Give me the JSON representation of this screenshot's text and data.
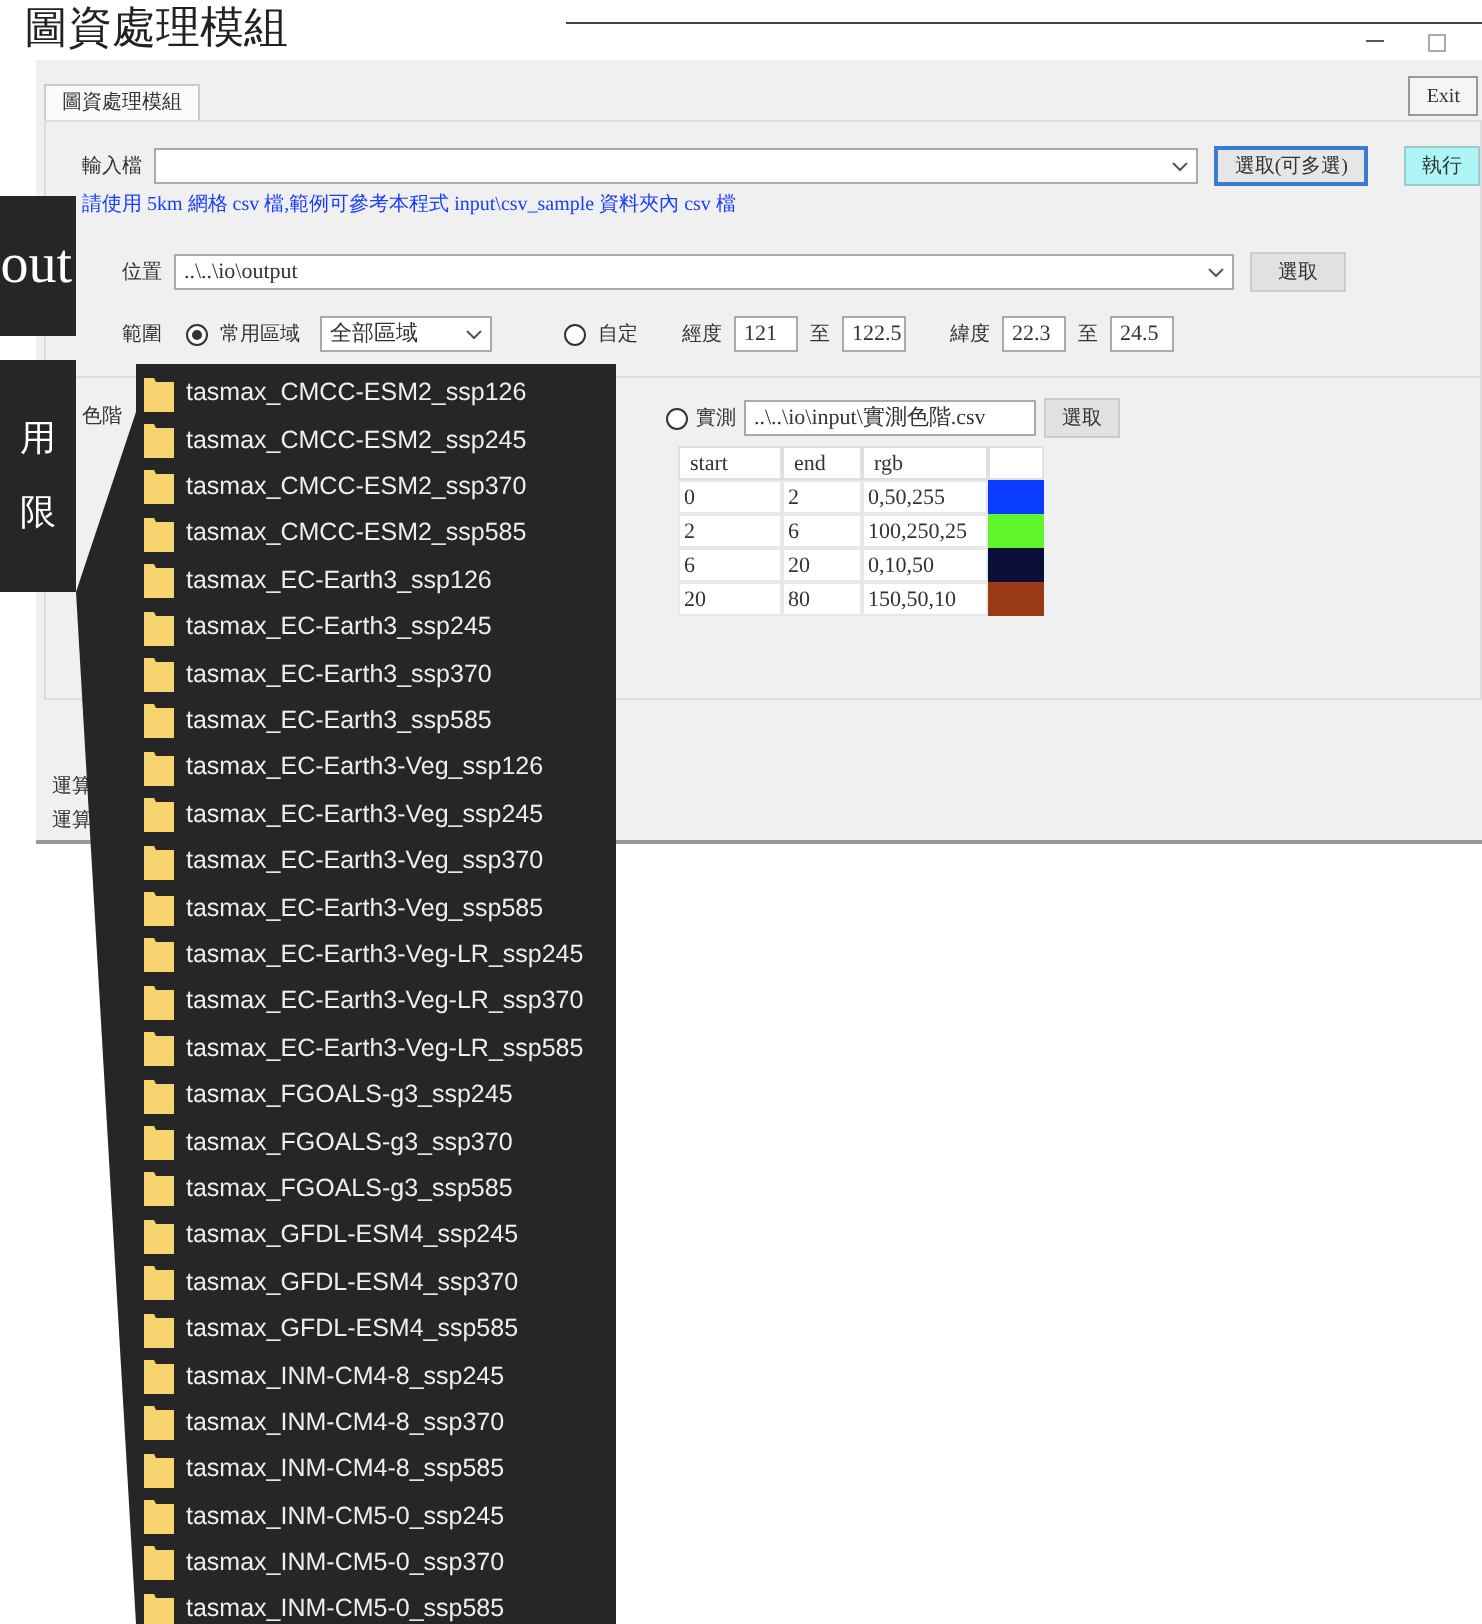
{
  "slide_title": "圖資處理模組",
  "window": {
    "tabs": [
      {
        "label": "圖資處理模組",
        "selected": true
      }
    ],
    "exit_button": "Exit",
    "input": {
      "label": "輸入檔",
      "button": "選取(可多選)",
      "run_button": "執行",
      "hint": "請使用 5km 網格 csv 檔,範例可參考本程式 input\\csv_sample 資料夾內 csv 檔"
    },
    "output": {
      "label": "位置",
      "value": "..\\..\\io\\output",
      "button": "選取"
    },
    "range": {
      "label": "範圍",
      "options": [
        {
          "kind": "preset",
          "label": "常用區域",
          "selected": true,
          "value": "全部區域"
        },
        {
          "kind": "custom",
          "label": "自定",
          "selected": false
        }
      ],
      "lon_label": "經度",
      "lon_from": "121",
      "lon_sep": "至",
      "lon_to": "122.5",
      "lat_label": "緯度",
      "lat_from": "22.3",
      "lat_sep": "至",
      "lat_to": "24.5"
    },
    "color_scale": {
      "label": "色階",
      "option": {
        "label": "實測",
        "selected": false
      },
      "file": "..\\..\\io\\input\\實測色階.csv",
      "button": "選取",
      "columns": [
        "start",
        "end",
        "rgb"
      ],
      "rows": [
        {
          "start": "0",
          "end": "2",
          "rgb": "0,50,255",
          "color": "#0a3cff"
        },
        {
          "start": "2",
          "end": "6",
          "rgb": "100,250,25",
          "color": "#5ef52a"
        },
        {
          "start": "6",
          "end": "20",
          "rgb": "0,10,50",
          "color": "#0a0f38"
        },
        {
          "start": "20",
          "end": "80",
          "rgb": "150,50,10",
          "color": "#9a3a14"
        }
      ]
    },
    "status_lines": [
      "運算",
      "運算"
    ]
  },
  "callouts": [
    "out",
    "用",
    "限"
  ],
  "file_list": [
    "tasmax_CMCC-ESM2_ssp126",
    "tasmax_CMCC-ESM2_ssp245",
    "tasmax_CMCC-ESM2_ssp370",
    "tasmax_CMCC-ESM2_ssp585",
    "tasmax_EC-Earth3_ssp126",
    "tasmax_EC-Earth3_ssp245",
    "tasmax_EC-Earth3_ssp370",
    "tasmax_EC-Earth3_ssp585",
    "tasmax_EC-Earth3-Veg_ssp126",
    "tasmax_EC-Earth3-Veg_ssp245",
    "tasmax_EC-Earth3-Veg_ssp370",
    "tasmax_EC-Earth3-Veg_ssp585",
    "tasmax_EC-Earth3-Veg-LR_ssp245",
    "tasmax_EC-Earth3-Veg-LR_ssp370",
    "tasmax_EC-Earth3-Veg-LR_ssp585",
    "tasmax_FGOALS-g3_ssp245",
    "tasmax_FGOALS-g3_ssp370",
    "tasmax_FGOALS-g3_ssp585",
    "tasmax_GFDL-ESM4_ssp245",
    "tasmax_GFDL-ESM4_ssp370",
    "tasmax_GFDL-ESM4_ssp585",
    "tasmax_INM-CM4-8_ssp245",
    "tasmax_INM-CM4-8_ssp370",
    "tasmax_INM-CM4-8_ssp585",
    "tasmax_INM-CM5-0_ssp245",
    "tasmax_INM-CM5-0_ssp370",
    "tasmax_INM-CM5-0_ssp585"
  ]
}
